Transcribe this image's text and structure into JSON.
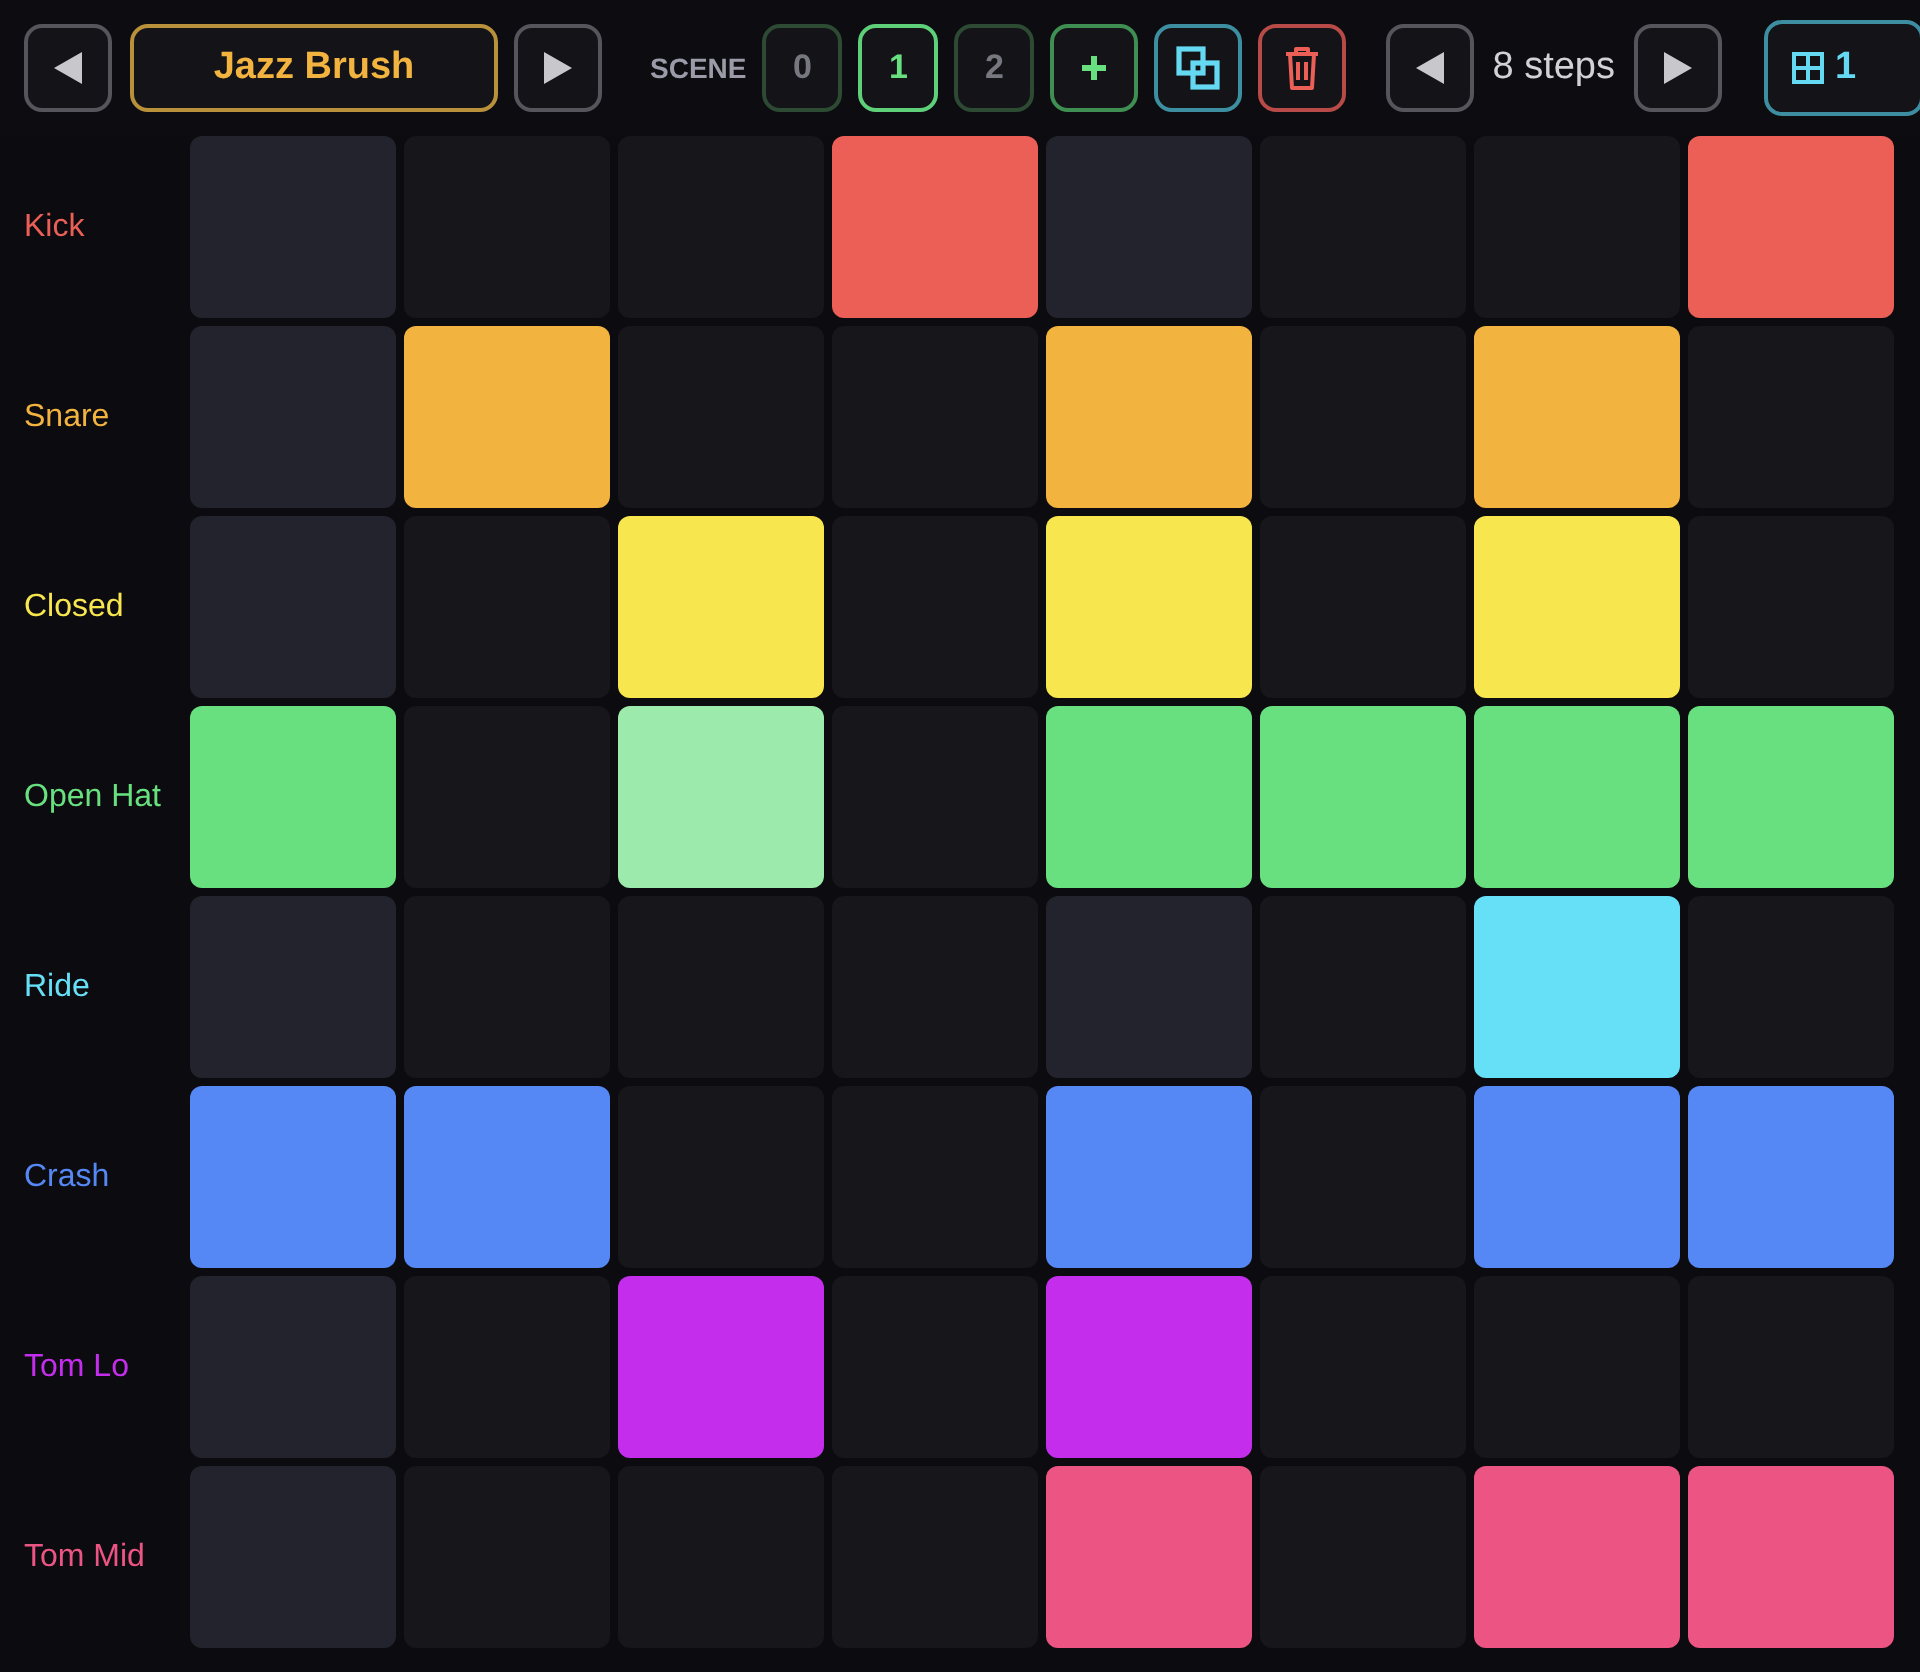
{
  "pattern": {
    "name": "Jazz Brush"
  },
  "scenes": {
    "label": "SCENE",
    "items": [
      {
        "label": "0",
        "selected": false
      },
      {
        "label": "1",
        "selected": true
      },
      {
        "label": "2",
        "selected": false
      }
    ]
  },
  "steps": {
    "label": "8 steps"
  },
  "page_button": {
    "label": "1"
  },
  "tracks": [
    {
      "name": "Kick",
      "color": "#ec5f57",
      "steps": [
        {
          "kind": "off"
        },
        {
          "kind": "off"
        },
        {
          "kind": "off"
        },
        {
          "kind": "on"
        },
        {
          "kind": "off"
        },
        {
          "kind": "off"
        },
        {
          "kind": "off"
        },
        {
          "kind": "on"
        }
      ]
    },
    {
      "name": "Snare",
      "color": "#f2b33f",
      "steps": [
        {
          "kind": "off"
        },
        {
          "kind": "on"
        },
        {
          "kind": "off"
        },
        {
          "kind": "off"
        },
        {
          "kind": "on"
        },
        {
          "kind": "off"
        },
        {
          "kind": "on"
        },
        {
          "kind": "off"
        }
      ]
    },
    {
      "name": "Closed",
      "color": "#f8e64e",
      "steps": [
        {
          "kind": "off"
        },
        {
          "kind": "off"
        },
        {
          "kind": "on"
        },
        {
          "kind": "off"
        },
        {
          "kind": "on"
        },
        {
          "kind": "off"
        },
        {
          "kind": "on"
        },
        {
          "kind": "off"
        }
      ]
    },
    {
      "name": "Open Hat",
      "color": "#68e07f",
      "steps": [
        {
          "kind": "on"
        },
        {
          "kind": "off"
        },
        {
          "kind": "ghost"
        },
        {
          "kind": "off"
        },
        {
          "kind": "on"
        },
        {
          "kind": "on"
        },
        {
          "kind": "on"
        },
        {
          "kind": "on"
        }
      ]
    },
    {
      "name": "Ride",
      "color": "#66e0f7",
      "steps": [
        {
          "kind": "off"
        },
        {
          "kind": "off"
        },
        {
          "kind": "off"
        },
        {
          "kind": "off"
        },
        {
          "kind": "off"
        },
        {
          "kind": "off"
        },
        {
          "kind": "on"
        },
        {
          "kind": "off"
        }
      ]
    },
    {
      "name": "Crash",
      "color": "#5688f5",
      "steps": [
        {
          "kind": "on"
        },
        {
          "kind": "on"
        },
        {
          "kind": "off"
        },
        {
          "kind": "off"
        },
        {
          "kind": "on"
        },
        {
          "kind": "off"
        },
        {
          "kind": "on"
        },
        {
          "kind": "on"
        }
      ]
    },
    {
      "name": "Tom Lo",
      "color": "#c52ded",
      "steps": [
        {
          "kind": "off"
        },
        {
          "kind": "off"
        },
        {
          "kind": "on"
        },
        {
          "kind": "off"
        },
        {
          "kind": "on"
        },
        {
          "kind": "off"
        },
        {
          "kind": "off"
        },
        {
          "kind": "off"
        }
      ]
    },
    {
      "name": "Tom Mid",
      "color": "#ec5483",
      "steps": [
        {
          "kind": "off"
        },
        {
          "kind": "off"
        },
        {
          "kind": "off"
        },
        {
          "kind": "off"
        },
        {
          "kind": "on"
        },
        {
          "kind": "off"
        },
        {
          "kind": "on"
        },
        {
          "kind": "on"
        }
      ]
    }
  ]
}
